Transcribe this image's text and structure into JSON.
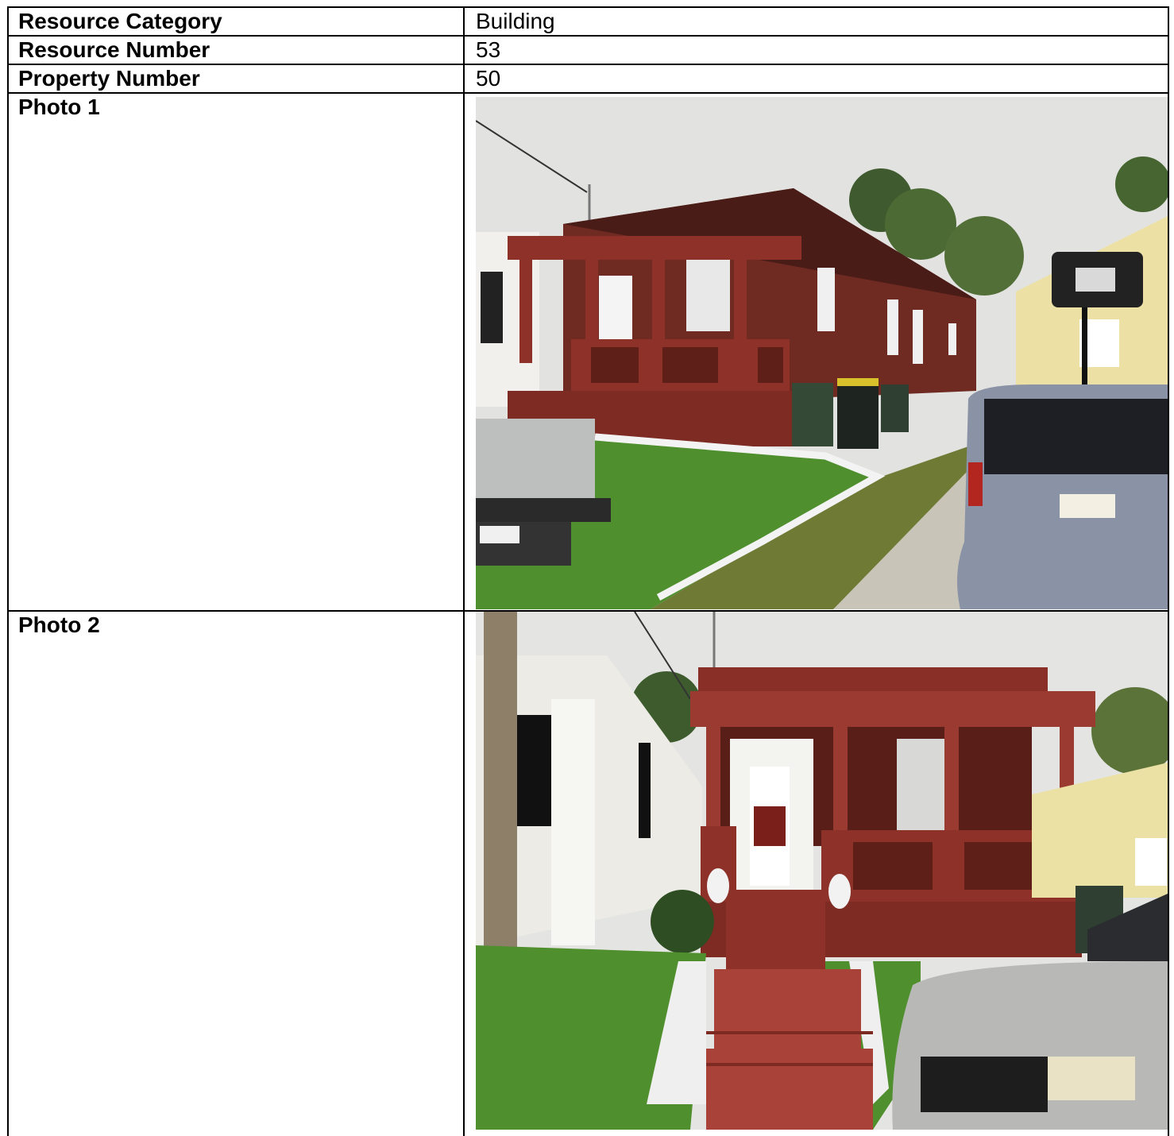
{
  "rows": [
    {
      "label": "Resource Category",
      "value": "Building"
    },
    {
      "label": "Resource Number",
      "value": "53"
    },
    {
      "label": "Property Number",
      "value": "50"
    }
  ],
  "photos": [
    {
      "label": "Photo 1",
      "image": "house-side-view-photo"
    },
    {
      "label": "Photo 2",
      "image": "house-front-view-photo"
    }
  ],
  "colors": {
    "brick": "#7a2a22",
    "porch_paint": "#8e3129",
    "lawn": "#4f8f2e",
    "sky": "#e4e5e3"
  }
}
